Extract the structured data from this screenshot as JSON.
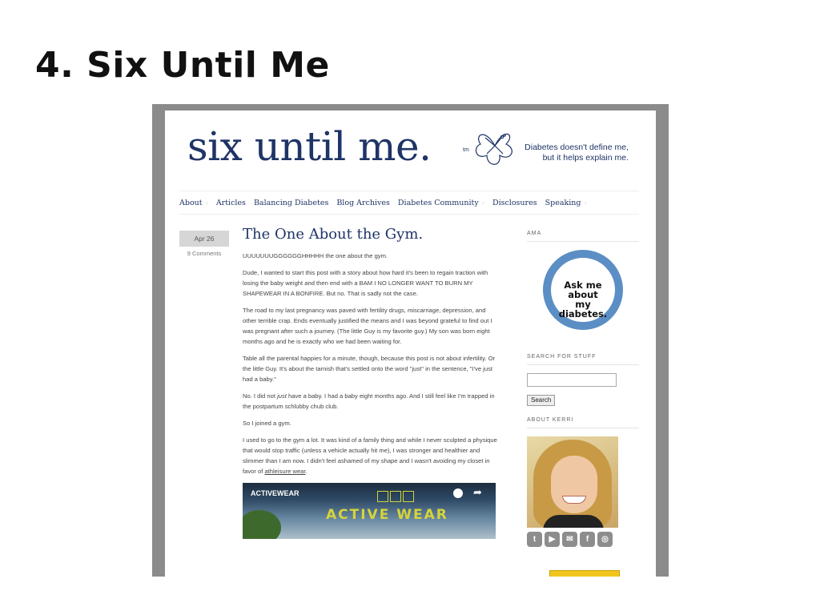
{
  "slide": {
    "title": "4. Six Until Me"
  },
  "site": {
    "logo_text": "six until me.",
    "logo_tm": "tm",
    "tagline_line1": "Diabetes doesn't define me,",
    "tagline_line2": "but it helps explain me."
  },
  "nav": {
    "items": [
      {
        "label": "About"
      },
      {
        "label": "Articles"
      },
      {
        "label": "Balancing Diabetes"
      },
      {
        "label": "Blog Archives"
      },
      {
        "label": "Diabetes Community"
      },
      {
        "label": "Disclosures"
      },
      {
        "label": "Speaking"
      }
    ]
  },
  "post": {
    "date": "Apr 26",
    "comments": "9 Comments",
    "title": "The One About the Gym.",
    "intro": "UUUUUUUGGGGGGHHHHH the one about the gym.",
    "p1": "Dude, I wanted to start this post with a story about how hard it's been to regain traction with losing the baby weight and then end with a BAM I NO LONGER WANT TO BURN MY SHAPEWEAR IN A BONFIRE.  But no.  That is sadly not the case.",
    "p2": "The road to my last pregnancy was paved with fertility drugs, miscarriage, depression, and other terrible crap.  Ends eventually justified the means and I was beyond grateful to find out I was pregnant after such a journey.  (The little Guy is my favorite guy.)  My son was born eight months ago and he is exactly who we had been waiting for.",
    "p3": "Table all the parental happies for a minute, though, because this post is not about infertility.  Or the little Guy.  It's about the tarnish that's settled onto the word \"just\" in the sentence, \"I've just had a baby.\"",
    "p4_a": "No.  I did not ",
    "p4_em": "just",
    "p4_b": " have a baby.  I had a baby eight months ago.  And I still feel like I'm trapped in the postpartum schlubby chub club.",
    "p5": "So I joined a gym.",
    "p6_a": "I used to go to the gym a lot.  It was kind of a family thing and while I never sculpted a physique that would stop traffic (unless a vehicle actually hit me), I was stronger and healthier and slimmer than I am now.  I didn't feel ashamed of my shape and I wasn't avoiding my closet in favor of ",
    "p6_link": "athleisure wear",
    "p6_b": ".",
    "video_label": "ACTIVEWEAR",
    "video_wordmark": "ACTIVE WEAR"
  },
  "sidebar": {
    "ama_title": "AMA",
    "ama_badge_line1": "Ask me about",
    "ama_badge_line2": "my diabetes.",
    "search_title": "Search for Stuff",
    "search_button": "Search",
    "about_title": "About Kerri",
    "social_icons": [
      "twitter-icon",
      "youtube-icon",
      "email-icon",
      "facebook-icon",
      "instagram-icon"
    ]
  },
  "colors": {
    "brand_navy": "#1f3466",
    "badge_blue": "#5b8ec4",
    "frame_gray": "#8b8b8b"
  }
}
